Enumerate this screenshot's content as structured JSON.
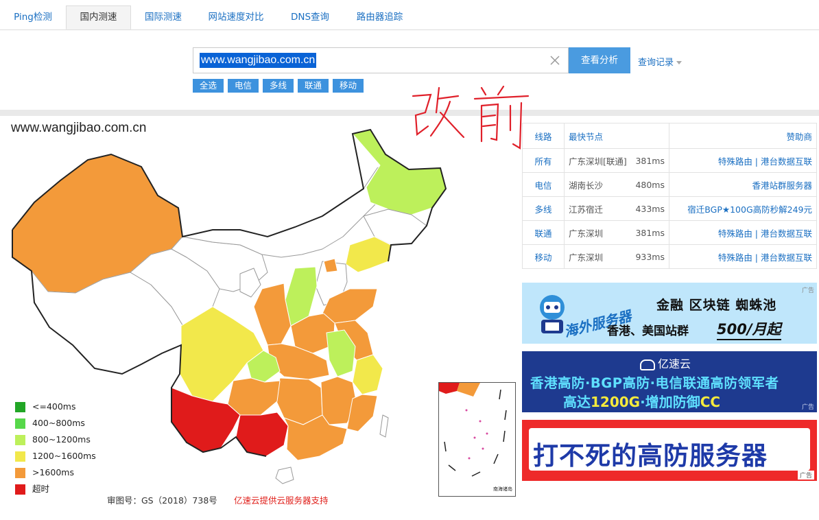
{
  "tabs": [
    {
      "label": "Ping检测",
      "active": false
    },
    {
      "label": "国内测速",
      "active": true
    },
    {
      "label": "国际测速",
      "active": false
    },
    {
      "label": "网站速度对比",
      "active": false
    },
    {
      "label": "DNS查询",
      "active": false
    },
    {
      "label": "路由器追踪",
      "active": false
    }
  ],
  "search": {
    "value": "www.wangjibao.com.cn",
    "clear_icon": "close-icon",
    "analyze_label": "查看分析",
    "history_label": "查询记录"
  },
  "filters": [
    "全选",
    "电信",
    "多线",
    "联通",
    "移动"
  ],
  "annotation": "改前",
  "map": {
    "domain": "www.wangjibao.com.cn",
    "legend": [
      {
        "label": "<=400ms",
        "color": "#22a626"
      },
      {
        "label": "400~800ms",
        "color": "#57d84a"
      },
      {
        "label": "800~1200ms",
        "color": "#bdf05b"
      },
      {
        "label": "1200~1600ms",
        "color": "#f2e84b"
      },
      {
        "label": ">1600ms",
        "color": "#f39a3a"
      },
      {
        "label": "超时",
        "color": "#e01b1b"
      }
    ],
    "approval": "审图号：GS（2018）738号",
    "support": "亿速云提供云服务器支持",
    "inset_label": "南海诸岛"
  },
  "table": {
    "headers": {
      "line": "线路",
      "node": "最快节点",
      "sponsor": "赞助商"
    },
    "rows": [
      {
        "line": "所有",
        "node": "广东深圳[联通]",
        "ms": "381ms",
        "sponsor": "特殊路由 | 港台数据互联"
      },
      {
        "line": "电信",
        "node": "湖南长沙",
        "ms": "480ms",
        "sponsor": "香港站群服务器"
      },
      {
        "line": "多线",
        "node": "江苏宿迁",
        "ms": "433ms",
        "sponsor": "宿迁BGP★100G高防秒解249元"
      },
      {
        "line": "联通",
        "node": "广东深圳",
        "ms": "381ms",
        "sponsor": "特殊路由 | 港台数据互联"
      },
      {
        "line": "移动",
        "node": "广东深圳",
        "ms": "933ms",
        "sponsor": "特殊路由 | 港台数据互联"
      }
    ]
  },
  "ads": {
    "tag": "广告",
    "ad1": {
      "title": "海外服务器",
      "line1": "金融  区块链  蜘蛛池",
      "line2": "香港、美国站群",
      "price": "500/月起"
    },
    "ad2": {
      "brand": "亿速云",
      "line1": "香港高防·BGP高防·电信联通高防领军者",
      "line2a": "高达",
      "line2b": "1200G",
      "line2c": "·增加防御",
      "line2d": "CC"
    },
    "ad3": {
      "text": "打不死的高防服务器"
    }
  }
}
